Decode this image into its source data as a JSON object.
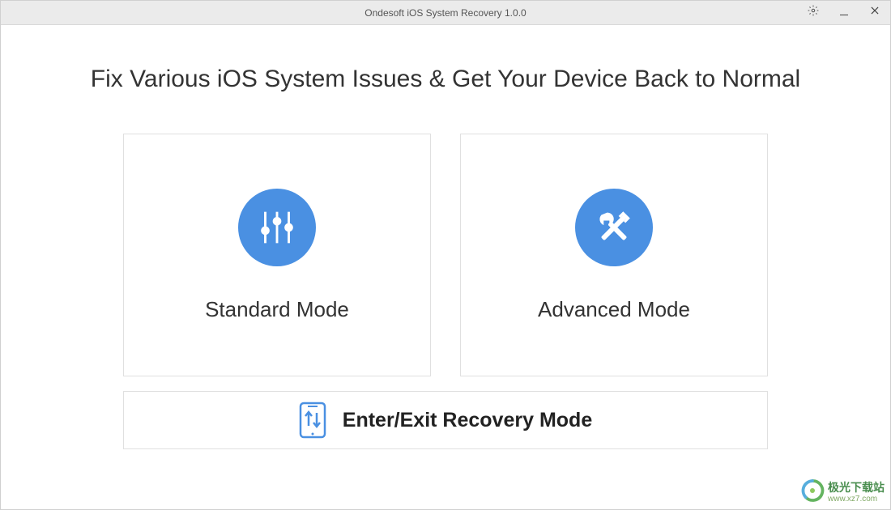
{
  "titlebar": {
    "title": "Ondesoft iOS System Recovery 1.0.0"
  },
  "heading": "Fix Various iOS System Issues & Get Your Device Back to Normal",
  "modes": {
    "standard": {
      "label": "Standard Mode",
      "icon": "sliders-icon"
    },
    "advanced": {
      "label": "Advanced Mode",
      "icon": "tools-icon"
    }
  },
  "recovery": {
    "label": "Enter/Exit Recovery Mode",
    "icon": "phone-arrows-icon"
  },
  "watermark": {
    "cn": "极光下载站",
    "url": "www.xz7.com"
  },
  "colors": {
    "accent": "#4a90e2"
  }
}
